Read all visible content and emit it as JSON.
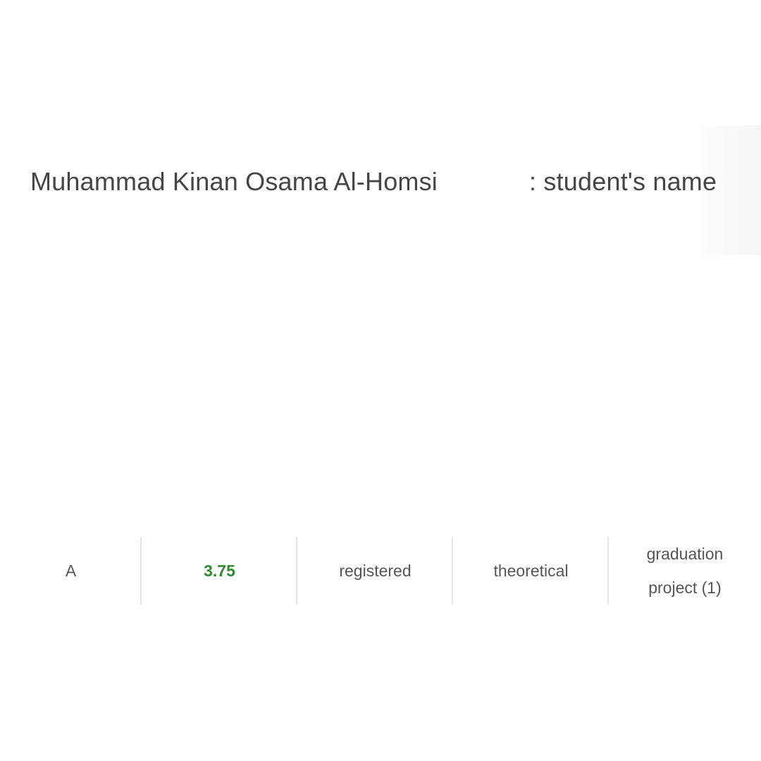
{
  "student": {
    "name": "Muhammad Kinan Osama Al-Homsi",
    "label": ": student's name"
  },
  "course": {
    "grade": "A",
    "points": "3.75",
    "status": "registered",
    "type": "theoretical",
    "name": "graduation\nproject (1)"
  },
  "colors": {
    "points": "#2e8b2e",
    "text": "#555555"
  }
}
